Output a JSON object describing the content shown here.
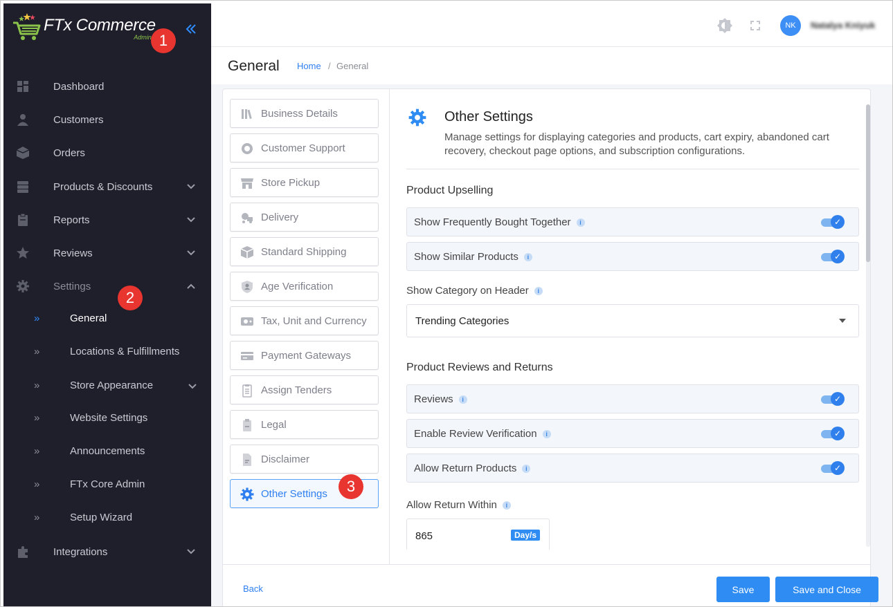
{
  "brand": {
    "name": "FTx Commerce",
    "sub": "Admin"
  },
  "sidebar": {
    "items": [
      {
        "label": "Dashboard",
        "icon": "dashboard-icon"
      },
      {
        "label": "Customers",
        "icon": "user-icon"
      },
      {
        "label": "Orders",
        "icon": "box-icon"
      },
      {
        "label": "Products & Discounts",
        "icon": "server-icon",
        "expandable": true
      },
      {
        "label": "Reports",
        "icon": "clipboard-icon",
        "expandable": true
      },
      {
        "label": "Reviews",
        "icon": "star-icon",
        "expandable": true
      },
      {
        "label": "Settings",
        "icon": "gear-icon",
        "expandable": true,
        "expanded": true
      },
      {
        "label": "Integrations",
        "icon": "puzzle-icon",
        "expandable": true
      }
    ],
    "settings_sub": [
      {
        "label": "General",
        "active": true
      },
      {
        "label": "Locations & Fulfillments"
      },
      {
        "label": "Store Appearance",
        "expandable": true
      },
      {
        "label": "Website Settings"
      },
      {
        "label": "Announcements"
      },
      {
        "label": "FTx Core Admin"
      },
      {
        "label": "Setup Wizard"
      }
    ]
  },
  "callouts": [
    "1",
    "2",
    "3"
  ],
  "topbar": {
    "avatar_initials": "NK",
    "username": "Natalya Kniyuk"
  },
  "page": {
    "title": "General",
    "breadcrumb_home": "Home",
    "breadcrumb_sep": "/",
    "breadcrumb_current": "General"
  },
  "settings_menu": [
    {
      "label": "Business Details",
      "icon": "books-icon"
    },
    {
      "label": "Customer Support",
      "icon": "support-icon"
    },
    {
      "label": "Store Pickup",
      "icon": "store-icon"
    },
    {
      "label": "Delivery",
      "icon": "delivery-icon"
    },
    {
      "label": "Standard Shipping",
      "icon": "package-icon"
    },
    {
      "label": "Age Verification",
      "icon": "age-shield-icon"
    },
    {
      "label": "Tax, Unit and Currency",
      "icon": "currency-icon"
    },
    {
      "label": "Payment Gateways",
      "icon": "card-icon"
    },
    {
      "label": "Assign Tenders",
      "icon": "list-clipboard-icon"
    },
    {
      "label": "Legal",
      "icon": "legal-icon"
    },
    {
      "label": "Disclaimer",
      "icon": "document-icon"
    },
    {
      "label": "Other Settings",
      "icon": "gear-icon",
      "active": true
    }
  ],
  "other_settings": {
    "title": "Other Settings",
    "description": "Manage settings for displaying categories and products, cart expiry, abandoned cart recovery, checkout page options, and subscription configurations.",
    "product_upselling": {
      "title": "Product Upselling",
      "toggles": [
        {
          "label": "Show Frequently Bought Together",
          "on": true
        },
        {
          "label": "Show Similar Products",
          "on": true
        }
      ]
    },
    "show_category_on_header": {
      "label": "Show Category on Header",
      "value": "Trending Categories"
    },
    "reviews_returns": {
      "title": "Product Reviews and Returns",
      "toggles": [
        {
          "label": "Reviews",
          "on": true
        },
        {
          "label": "Enable Review Verification",
          "on": true
        },
        {
          "label": "Allow Return Products",
          "on": true
        }
      ]
    },
    "allow_return_within": {
      "label": "Allow Return Within",
      "value": "865",
      "unit": "Day/s"
    }
  },
  "footer": {
    "back": "Back",
    "save": "Save",
    "save_close": "Save and Close"
  },
  "colors": {
    "sidebar_bg": "#1f1f2b",
    "accent": "#2f8cf2",
    "badge": "#e8352f"
  }
}
